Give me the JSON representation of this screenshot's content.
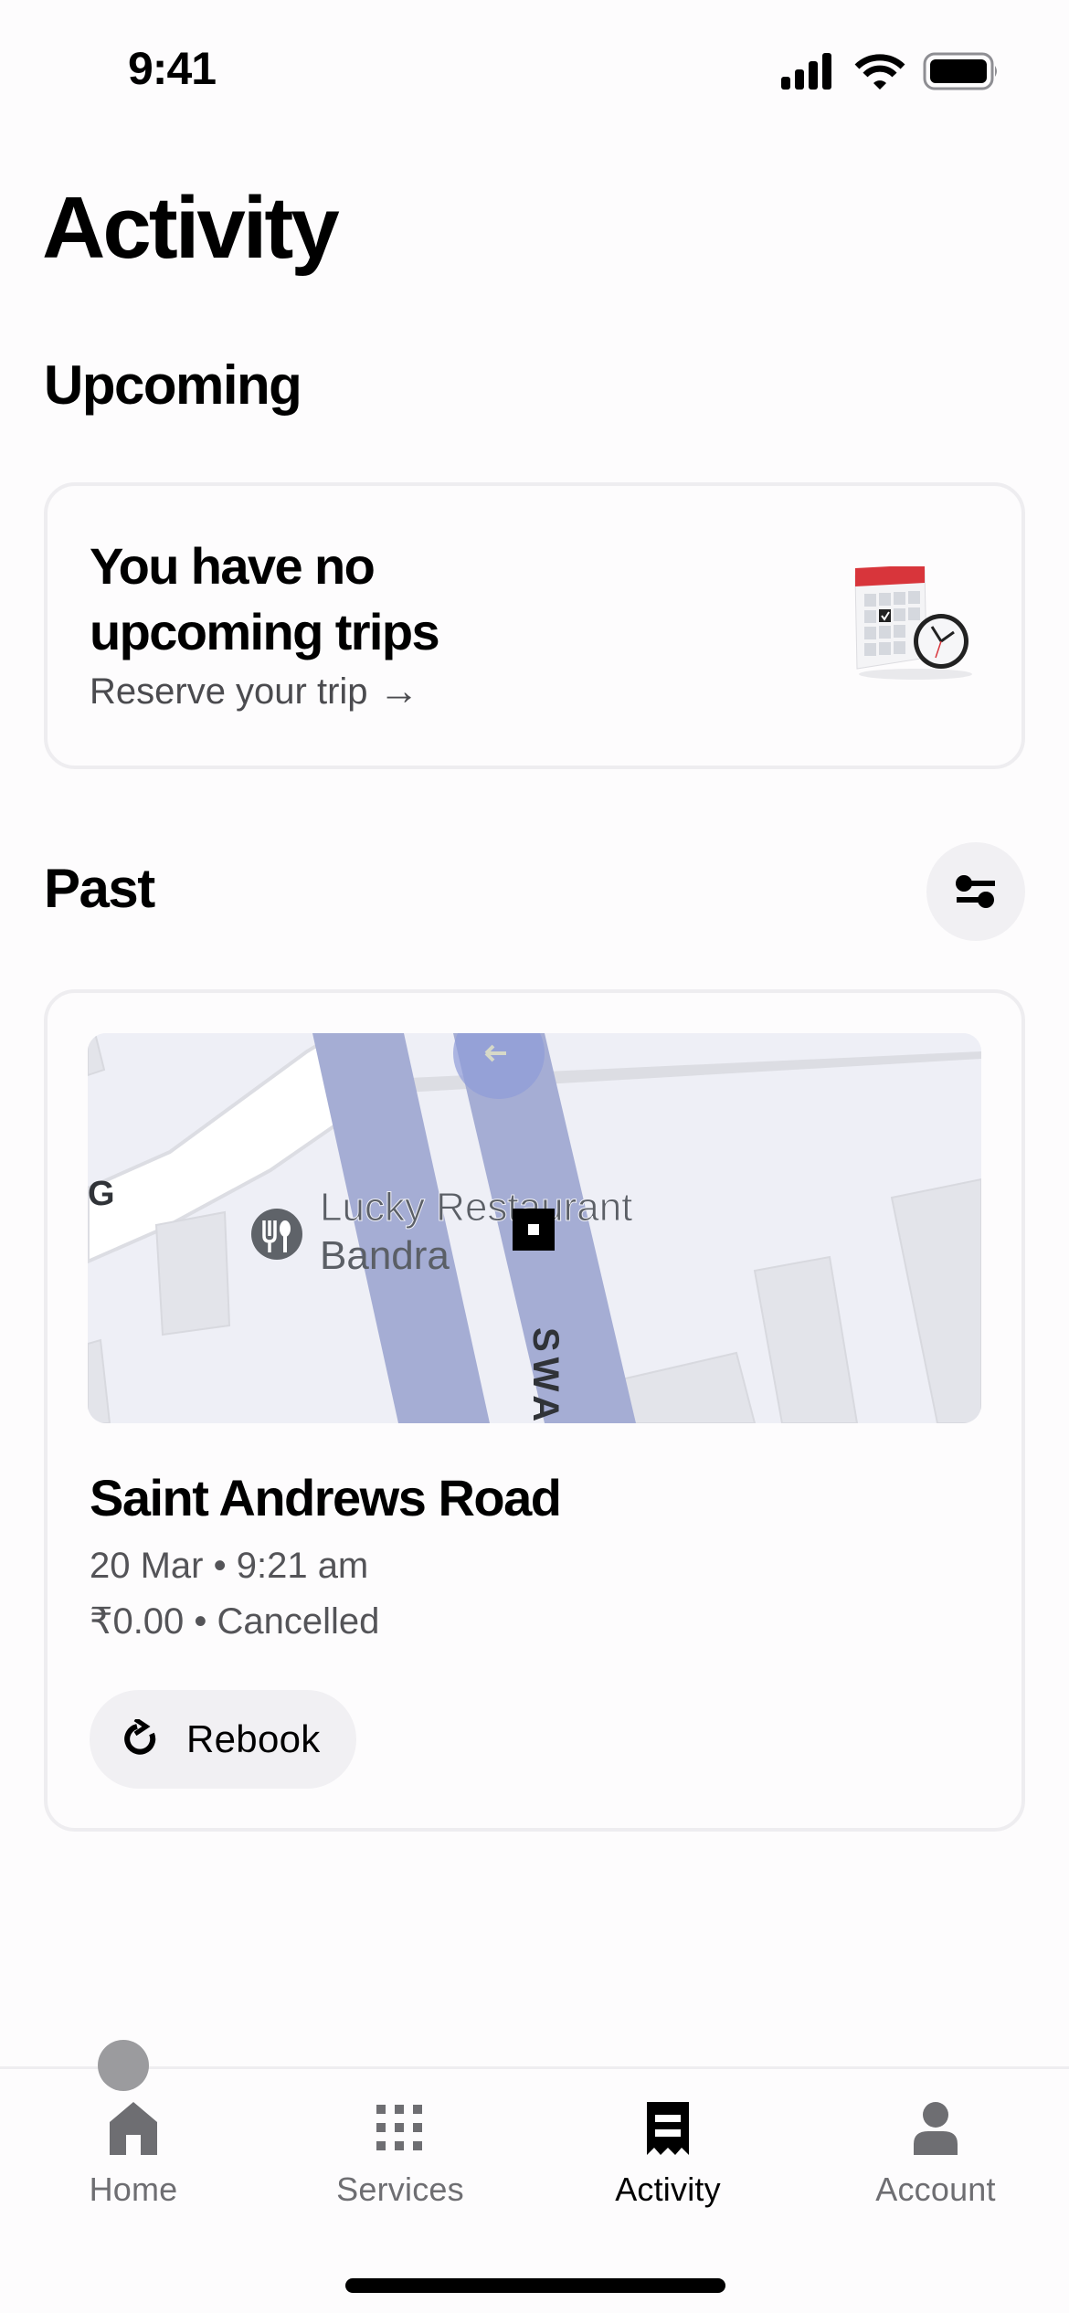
{
  "status_bar": {
    "time": "9:41",
    "icons": [
      "cellular-signal-icon",
      "wifi-icon",
      "battery-icon"
    ]
  },
  "page": {
    "title": "Activity"
  },
  "upcoming": {
    "section_title": "Upcoming",
    "card": {
      "heading": "You have no upcoming trips",
      "link_label": "Reserve your trip",
      "link_arrow": "→",
      "illustration": "calendar-clock-illustration"
    }
  },
  "past": {
    "section_title": "Past",
    "filter_icon": "filter-sliders-icon",
    "trips": [
      {
        "map": {
          "poi_label_line1": "Lucky Restaurant",
          "poi_label_line2": "Bandra",
          "poi_icon": "restaurant-icon",
          "road_label": "SWA",
          "edge_label": "G",
          "colors": {
            "land": "#eeeff6",
            "route": "#a5add4",
            "road": "#ffffff",
            "building": "#e3e4ea"
          }
        },
        "destination": "Saint Andrews Road",
        "date_time": "20 Mar • 9:21 am",
        "fare_status": "₹0.00 • Cancelled",
        "rebook_label": "Rebook"
      }
    ]
  },
  "bottom_nav": {
    "items": [
      {
        "label": "Home",
        "icon": "home-icon",
        "active": false
      },
      {
        "label": "Services",
        "icon": "grid-icon",
        "active": false
      },
      {
        "label": "Activity",
        "icon": "receipt-icon",
        "active": true
      },
      {
        "label": "Account",
        "icon": "person-icon",
        "active": false
      }
    ]
  }
}
